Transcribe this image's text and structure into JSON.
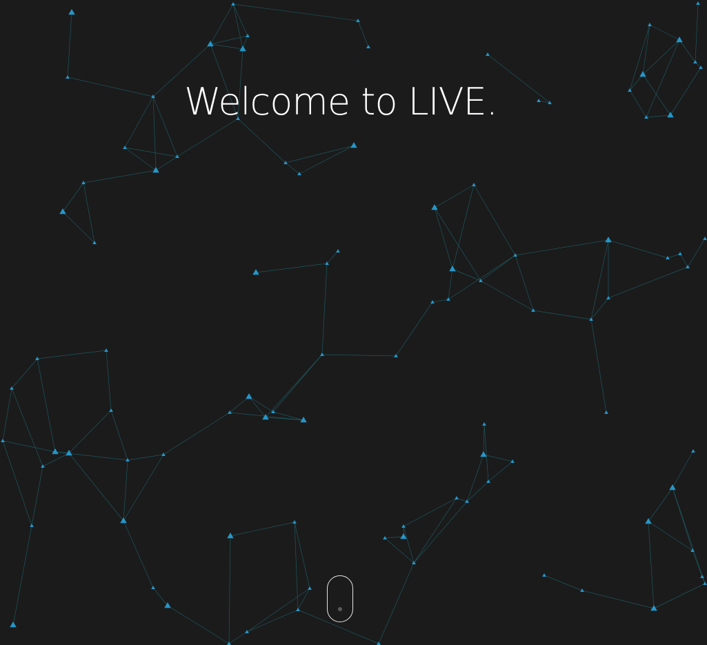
{
  "hero": {
    "title": "Welcome to LIVE."
  },
  "scroll_indicator": {
    "icon": "mouse-scroll-icon"
  },
  "theme": {
    "background": "#1b1b1c",
    "line_color": "#1f6b70",
    "node_color": "#2696c8",
    "text_color": "#ffffff"
  }
}
